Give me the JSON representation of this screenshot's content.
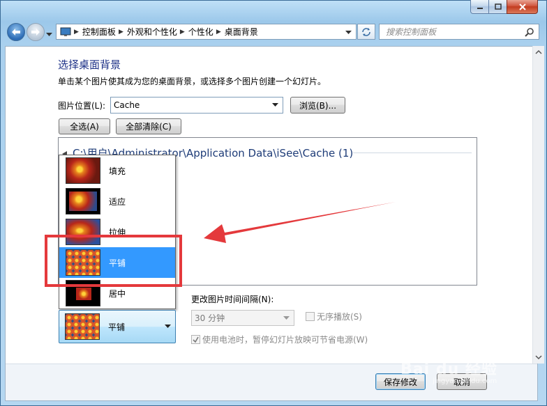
{
  "titlebar": {
    "min_icon": "minimize-icon",
    "max_icon": "maximize-icon",
    "close_icon": "close-icon"
  },
  "nav": {
    "breadcrumbs": [
      "控制面板",
      "外观和个性化",
      "个性化",
      "桌面背景"
    ],
    "search_placeholder": "搜索控制面板"
  },
  "page": {
    "title": "选择桌面背景",
    "description": "单击某个图片使其成为您的桌面背景，或选择多个图片创建一个幻灯片。",
    "location_label": "图片位置(L):",
    "location_value": "Cache",
    "browse_label": "浏览(B)...",
    "select_all_label": "全选(A)",
    "clear_all_label": "全部清除(C)",
    "group_header": "C:\\用户\\Administrator\\Application Data\\iSee\\Cache (1)"
  },
  "position": {
    "options": [
      "填充",
      "适应",
      "拉伸",
      "平铺",
      "居中"
    ],
    "selected": "平铺"
  },
  "slideshow": {
    "interval_label": "更改图片时间间隔(N):",
    "interval_value": "30 分钟",
    "shuffle_label": "无序播放(S)",
    "battery_label": "使用电池时，暂停幻灯片放映可节省电源(W)",
    "battery_checked": true
  },
  "footer": {
    "save_label": "保存修改",
    "cancel_label": "取消"
  },
  "watermark": {
    "text": "Bai du 经验",
    "sub": "jingyan.baidu.com"
  },
  "colors": {
    "highlight": "#e4393c",
    "selected": "#3399ff"
  }
}
